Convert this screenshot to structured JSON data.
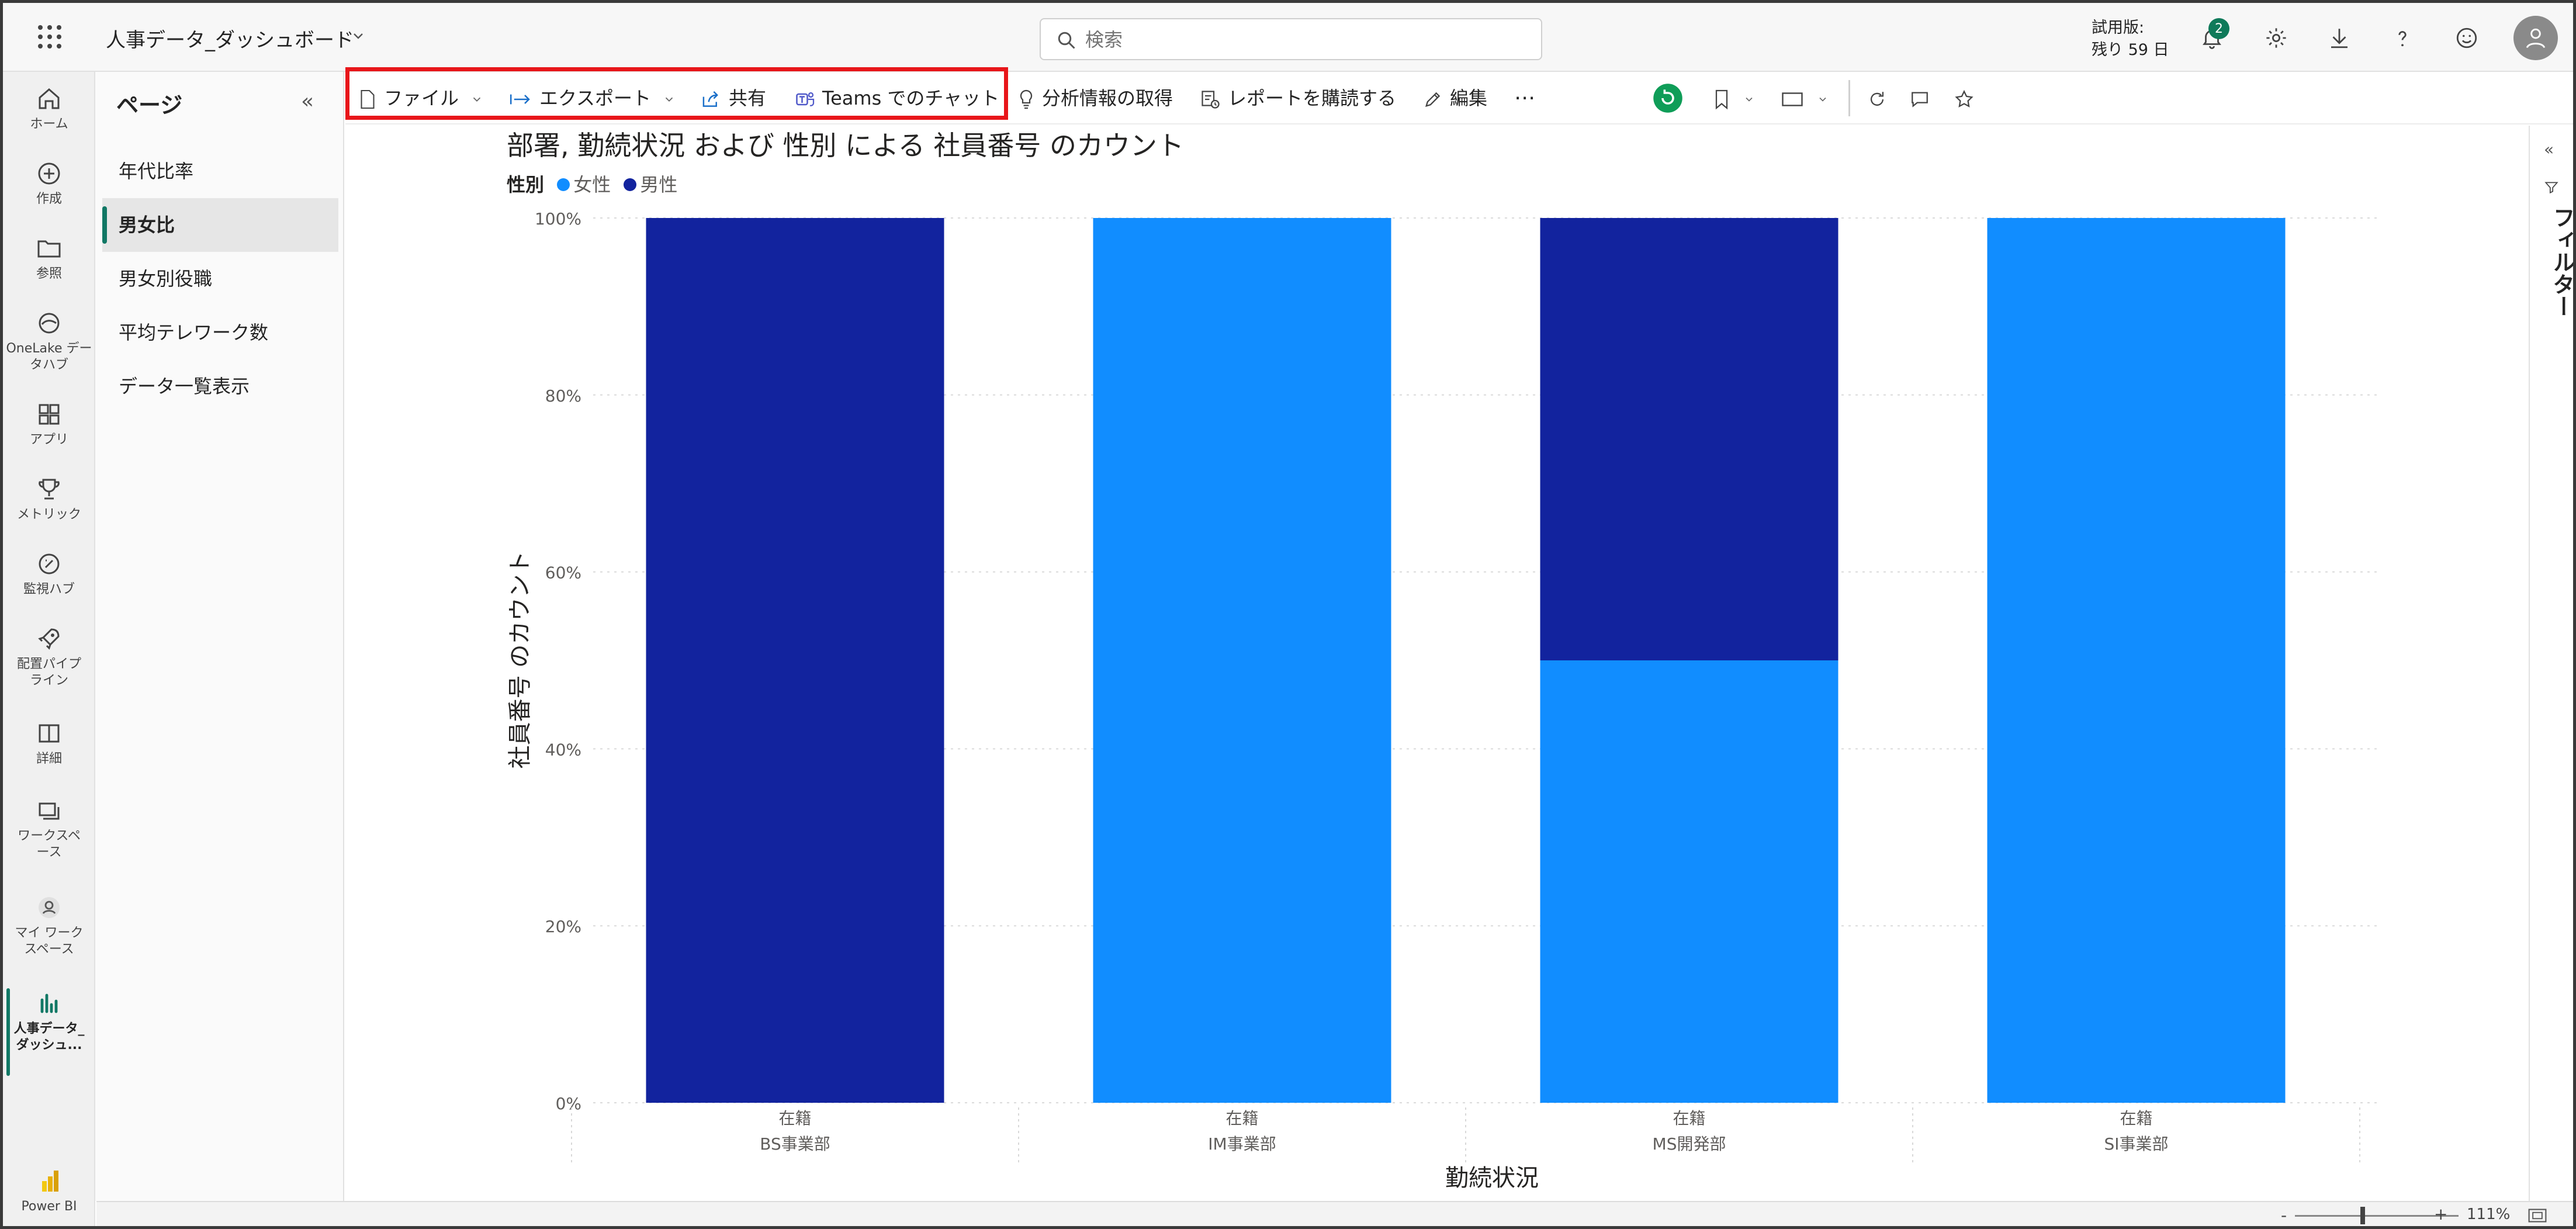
{
  "app": {
    "title": "人事データ_ダッシュボード",
    "search_placeholder": "検索",
    "trial_line1": "試用版:",
    "trial_line2": "残り 59 日",
    "notifications_count": "2",
    "brand_label": "Power BI"
  },
  "rail": [
    {
      "label": "ホーム",
      "icon": "home-icon"
    },
    {
      "label": "作成",
      "icon": "plus-circle-icon"
    },
    {
      "label": "参照",
      "icon": "folder-icon"
    },
    {
      "label": "OneLake データハブ",
      "icon": "onelake-icon"
    },
    {
      "label": "アプリ",
      "icon": "apps-icon"
    },
    {
      "label": "メトリック",
      "icon": "trophy-icon"
    },
    {
      "label": "監視ハブ",
      "icon": "monitor-icon"
    },
    {
      "label": "配置パイプライン",
      "icon": "rocket-icon"
    },
    {
      "label": "詳細",
      "icon": "book-icon"
    },
    {
      "label": "ワークスペース",
      "icon": "workspaces-icon"
    },
    {
      "label": "マイ ワークスペース",
      "icon": "person-icon"
    },
    {
      "label": "人事データ_ダッシュ...",
      "icon": "report-icon"
    }
  ],
  "pages_pane": {
    "title": "ページ",
    "items": [
      "年代比率",
      "男女比",
      "男女別役職",
      "平均テレワーク数",
      "データ一覧表示"
    ],
    "active_index": 1
  },
  "actions": {
    "file": "ファイル",
    "export": "エクスポート",
    "share": "共有",
    "teams": "Teams でのチャット",
    "insights": "分析情報の取得",
    "subscribe": "レポートを購読する",
    "edit": "編集",
    "more": "⋯"
  },
  "filters_label": "フィルター",
  "zoom": "111%",
  "colors": {
    "female": "#118dff",
    "male": "#12239e",
    "accent": "#117865",
    "highlight": "#e8161a"
  },
  "chart_data": {
    "type": "bar",
    "stacked": "100%",
    "title": "部署, 勤続状況 および 性別 による 社員番号 のカウント",
    "legend_title": "性別",
    "xlabel": "勤続状況",
    "ylabel": "社員番号 のカウント",
    "ylim": [
      0,
      100
    ],
    "yticks": [
      "0%",
      "20%",
      "40%",
      "60%",
      "80%",
      "100%"
    ],
    "categories": [
      {
        "status": "在籍",
        "dept": "BS事業部"
      },
      {
        "status": "在籍",
        "dept": "IM事業部"
      },
      {
        "status": "在籍",
        "dept": "MS開発部"
      },
      {
        "status": "在籍",
        "dept": "SI事業部"
      }
    ],
    "series": [
      {
        "name": "女性",
        "values": [
          0,
          100,
          50,
          100
        ]
      },
      {
        "name": "男性",
        "values": [
          100,
          0,
          50,
          0
        ]
      }
    ],
    "grid": true
  }
}
